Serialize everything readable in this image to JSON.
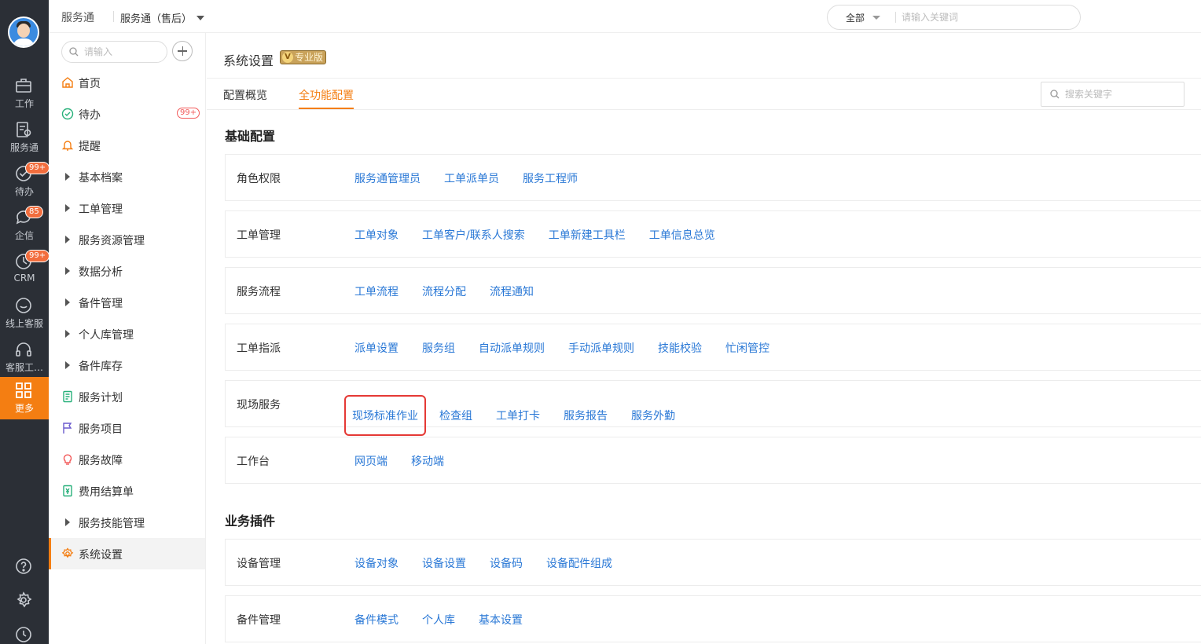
{
  "rail": {
    "items": [
      {
        "label": "工作",
        "icon": "briefcase-icon"
      },
      {
        "label": "服务通",
        "icon": "service-doc-icon"
      },
      {
        "label": "待办",
        "icon": "check-circle-icon",
        "badge": "99+"
      },
      {
        "label": "企信",
        "icon": "chat-bubble-icon",
        "badge": "85"
      },
      {
        "label": "CRM",
        "icon": "clock-icon",
        "badge": "99+"
      },
      {
        "label": "线上客服",
        "icon": "smile-chat-icon"
      },
      {
        "label": "客服工…",
        "icon": "headset-icon"
      },
      {
        "label": "更多",
        "icon": "grid-icon",
        "active": true
      }
    ],
    "bottom_icons": [
      "help-icon",
      "settings-icon",
      "history-icon"
    ]
  },
  "topbar": {
    "app_name": "服务通",
    "sub_app": "服务通（售后）",
    "search_scope": "全部",
    "search_placeholder": "请输入关键词"
  },
  "menu": {
    "search_placeholder": "请输入",
    "items": [
      {
        "label": "首页",
        "icon": "home-icon"
      },
      {
        "label": "待办",
        "icon": "check-circle-icon",
        "badge": "99+"
      },
      {
        "label": "提醒",
        "icon": "bell-icon"
      },
      {
        "label": "基本档案",
        "expandable": true
      },
      {
        "label": "工单管理",
        "expandable": true
      },
      {
        "label": "服务资源管理",
        "expandable": true
      },
      {
        "label": "数据分析",
        "expandable": true
      },
      {
        "label": "备件管理",
        "expandable": true
      },
      {
        "label": "个人库管理",
        "expandable": true
      },
      {
        "label": "备件库存",
        "expandable": true
      },
      {
        "label": "服务计划",
        "icon": "plan-doc-icon"
      },
      {
        "label": "服务项目",
        "icon": "flag-icon"
      },
      {
        "label": "服务故障",
        "icon": "bulb-icon"
      },
      {
        "label": "费用结算单",
        "icon": "yen-doc-icon"
      },
      {
        "label": "服务技能管理",
        "expandable": true
      },
      {
        "label": "系统设置",
        "icon": "gear-icon",
        "active": true
      }
    ]
  },
  "main": {
    "title": "系统设置",
    "edition": "专业版",
    "edition_icon_letter": "V",
    "tabs": [
      "配置概览",
      "全功能配置"
    ],
    "active_tab": 1,
    "keyword_placeholder": "搜索关键字",
    "sections": [
      {
        "title": "基础配置",
        "rows": [
          {
            "label": "角色权限",
            "links": [
              "服务通管理员",
              "工单派单员",
              "服务工程师"
            ]
          },
          {
            "label": "工单管理",
            "links": [
              "工单对象",
              "工单客户/联系人搜索",
              "工单新建工具栏",
              "工单信息总览"
            ]
          },
          {
            "label": "服务流程",
            "links": [
              "工单流程",
              "流程分配",
              "流程通知"
            ]
          },
          {
            "label": "工单指派",
            "links": [
              "派单设置",
              "服务组",
              "自动派单规则",
              "手动派单规则",
              "技能校验",
              "忙闲管控"
            ]
          },
          {
            "label": "现场服务",
            "links": [
              "现场标准作业",
              "检查组",
              "工单打卡",
              "服务报告",
              "服务外勤"
            ],
            "highlight": 0
          },
          {
            "label": "工作台",
            "links": [
              "网页端",
              "移动端"
            ]
          }
        ]
      },
      {
        "title": "业务插件",
        "rows": [
          {
            "label": "设备管理",
            "links": [
              "设备对象",
              "设备设置",
              "设备码",
              "设备配件组成"
            ]
          },
          {
            "label": "备件管理",
            "links": [
              "备件模式",
              "个人库",
              "基本设置"
            ]
          }
        ]
      }
    ]
  },
  "colors": {
    "accent": "#f47e12",
    "link": "#2a78d6",
    "rail_bg": "#2b2f36",
    "badge_red": "#f26d3d",
    "highlight_box": "#e53935"
  }
}
